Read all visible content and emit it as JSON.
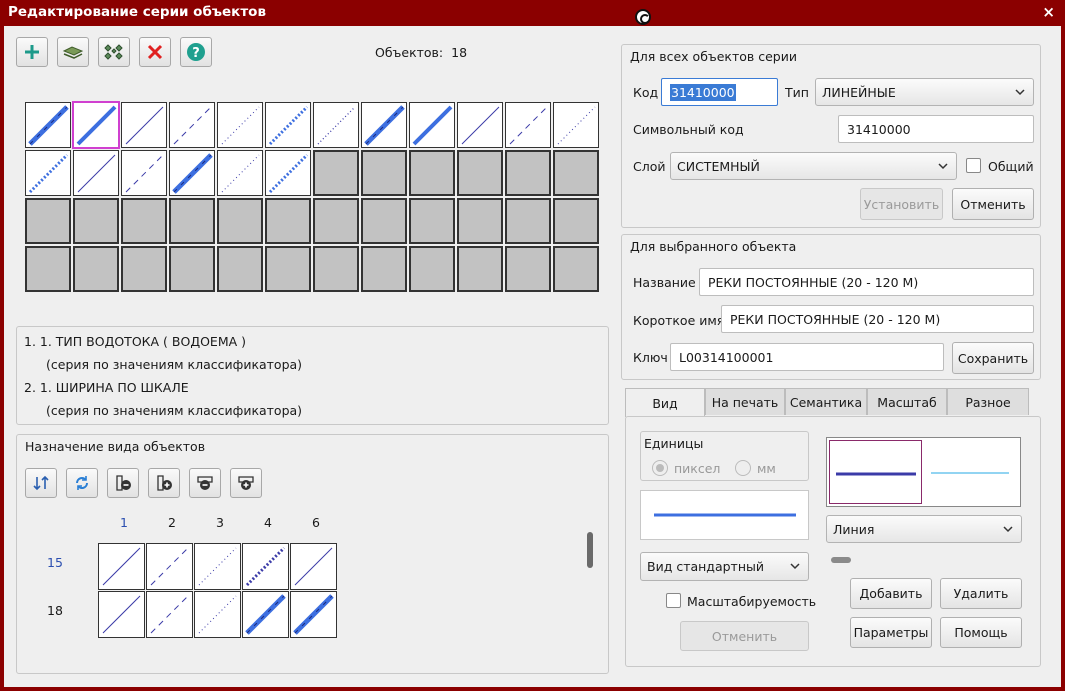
{
  "window": {
    "title": "Редактирование серии объектов",
    "close_glyph": "×"
  },
  "toolbar": {
    "items": [
      {
        "name": "add-button",
        "icon": "plus-icon"
      },
      {
        "name": "fill-button",
        "icon": "layers-icon"
      },
      {
        "name": "group-button",
        "icon": "grid-diamonds-icon"
      },
      {
        "name": "delete-button",
        "icon": "red-x-icon"
      },
      {
        "name": "help-button",
        "icon": "help-icon"
      }
    ]
  },
  "objects_count": {
    "label": "Объектов:",
    "value": "18"
  },
  "series_list": {
    "items": [
      {
        "title": "1.  1. ТИП ВОДОТОКА ( ВОДОЕМА )",
        "subtitle": "(серия по значениям классификатора)"
      },
      {
        "title": "2.  1. ШИРИНА ПО ШКАЛЕ",
        "subtitle": "(серия по значениям классификатора)"
      }
    ]
  },
  "assign_panel": {
    "title": "Назначение вида объектов",
    "columns": [
      "1",
      "2",
      "3",
      "4",
      "6"
    ],
    "rows": [
      "15",
      "18"
    ],
    "tools": [
      {
        "name": "arrange-button",
        "icon": "arrange-icon"
      },
      {
        "name": "refresh-button",
        "icon": "refresh-icon"
      },
      {
        "name": "remove-column-button",
        "icon": "remove-column-icon"
      },
      {
        "name": "add-column-button",
        "icon": "add-column-icon"
      },
      {
        "name": "remove-row-button",
        "icon": "remove-row-icon"
      },
      {
        "name": "add-row-button",
        "icon": "add-row-icon"
      }
    ]
  },
  "all_objects": {
    "title": "Для всех объектов серии",
    "code_label": "Код",
    "code_value": "31410000",
    "type_label": "Тип",
    "type_value": "ЛИНЕЙНЫЕ",
    "symcode_label": "Символьный код",
    "symcode_value": "31410000",
    "layer_label": "Слой",
    "layer_value": "СИСТЕМНЫЙ",
    "common_label": "Общий",
    "set_label": "Установить",
    "cancel_label": "Отменить"
  },
  "selected_object": {
    "title": "Для выбранного объекта",
    "name_label": "Название",
    "name_value": "РЕКИ ПОСТОЯННЫЕ (20 - 120 М)",
    "short_label": "Короткое имя",
    "short_value": "РЕКИ ПОСТОЯННЫЕ (20 - 120 М)",
    "key_label": "Ключ",
    "key_value": "L00314100001",
    "save_label": "Сохранить"
  },
  "tabs": [
    "Вид",
    "На печать",
    "Семантика",
    "Масштаб",
    "Разное"
  ],
  "view_tab": {
    "units_label": "Единицы",
    "unit_pixel": "пиксел",
    "unit_mm": "мм",
    "view_select": "Вид стандартный",
    "scalable_label": "Масштабируемость",
    "cancel_label": "Отменить",
    "primitive_select": "Линия",
    "add_label": "Добавить",
    "delete_label": "Удалить",
    "params_label": "Параметры",
    "help_label": "Помощь"
  },
  "colors": {
    "title_bar": "#8b0000",
    "line_blue": "#3d6fe0",
    "line_navy": "#3b3ba8",
    "preview_cyan": "#6ec6ee",
    "selection": "#d040d0"
  }
}
